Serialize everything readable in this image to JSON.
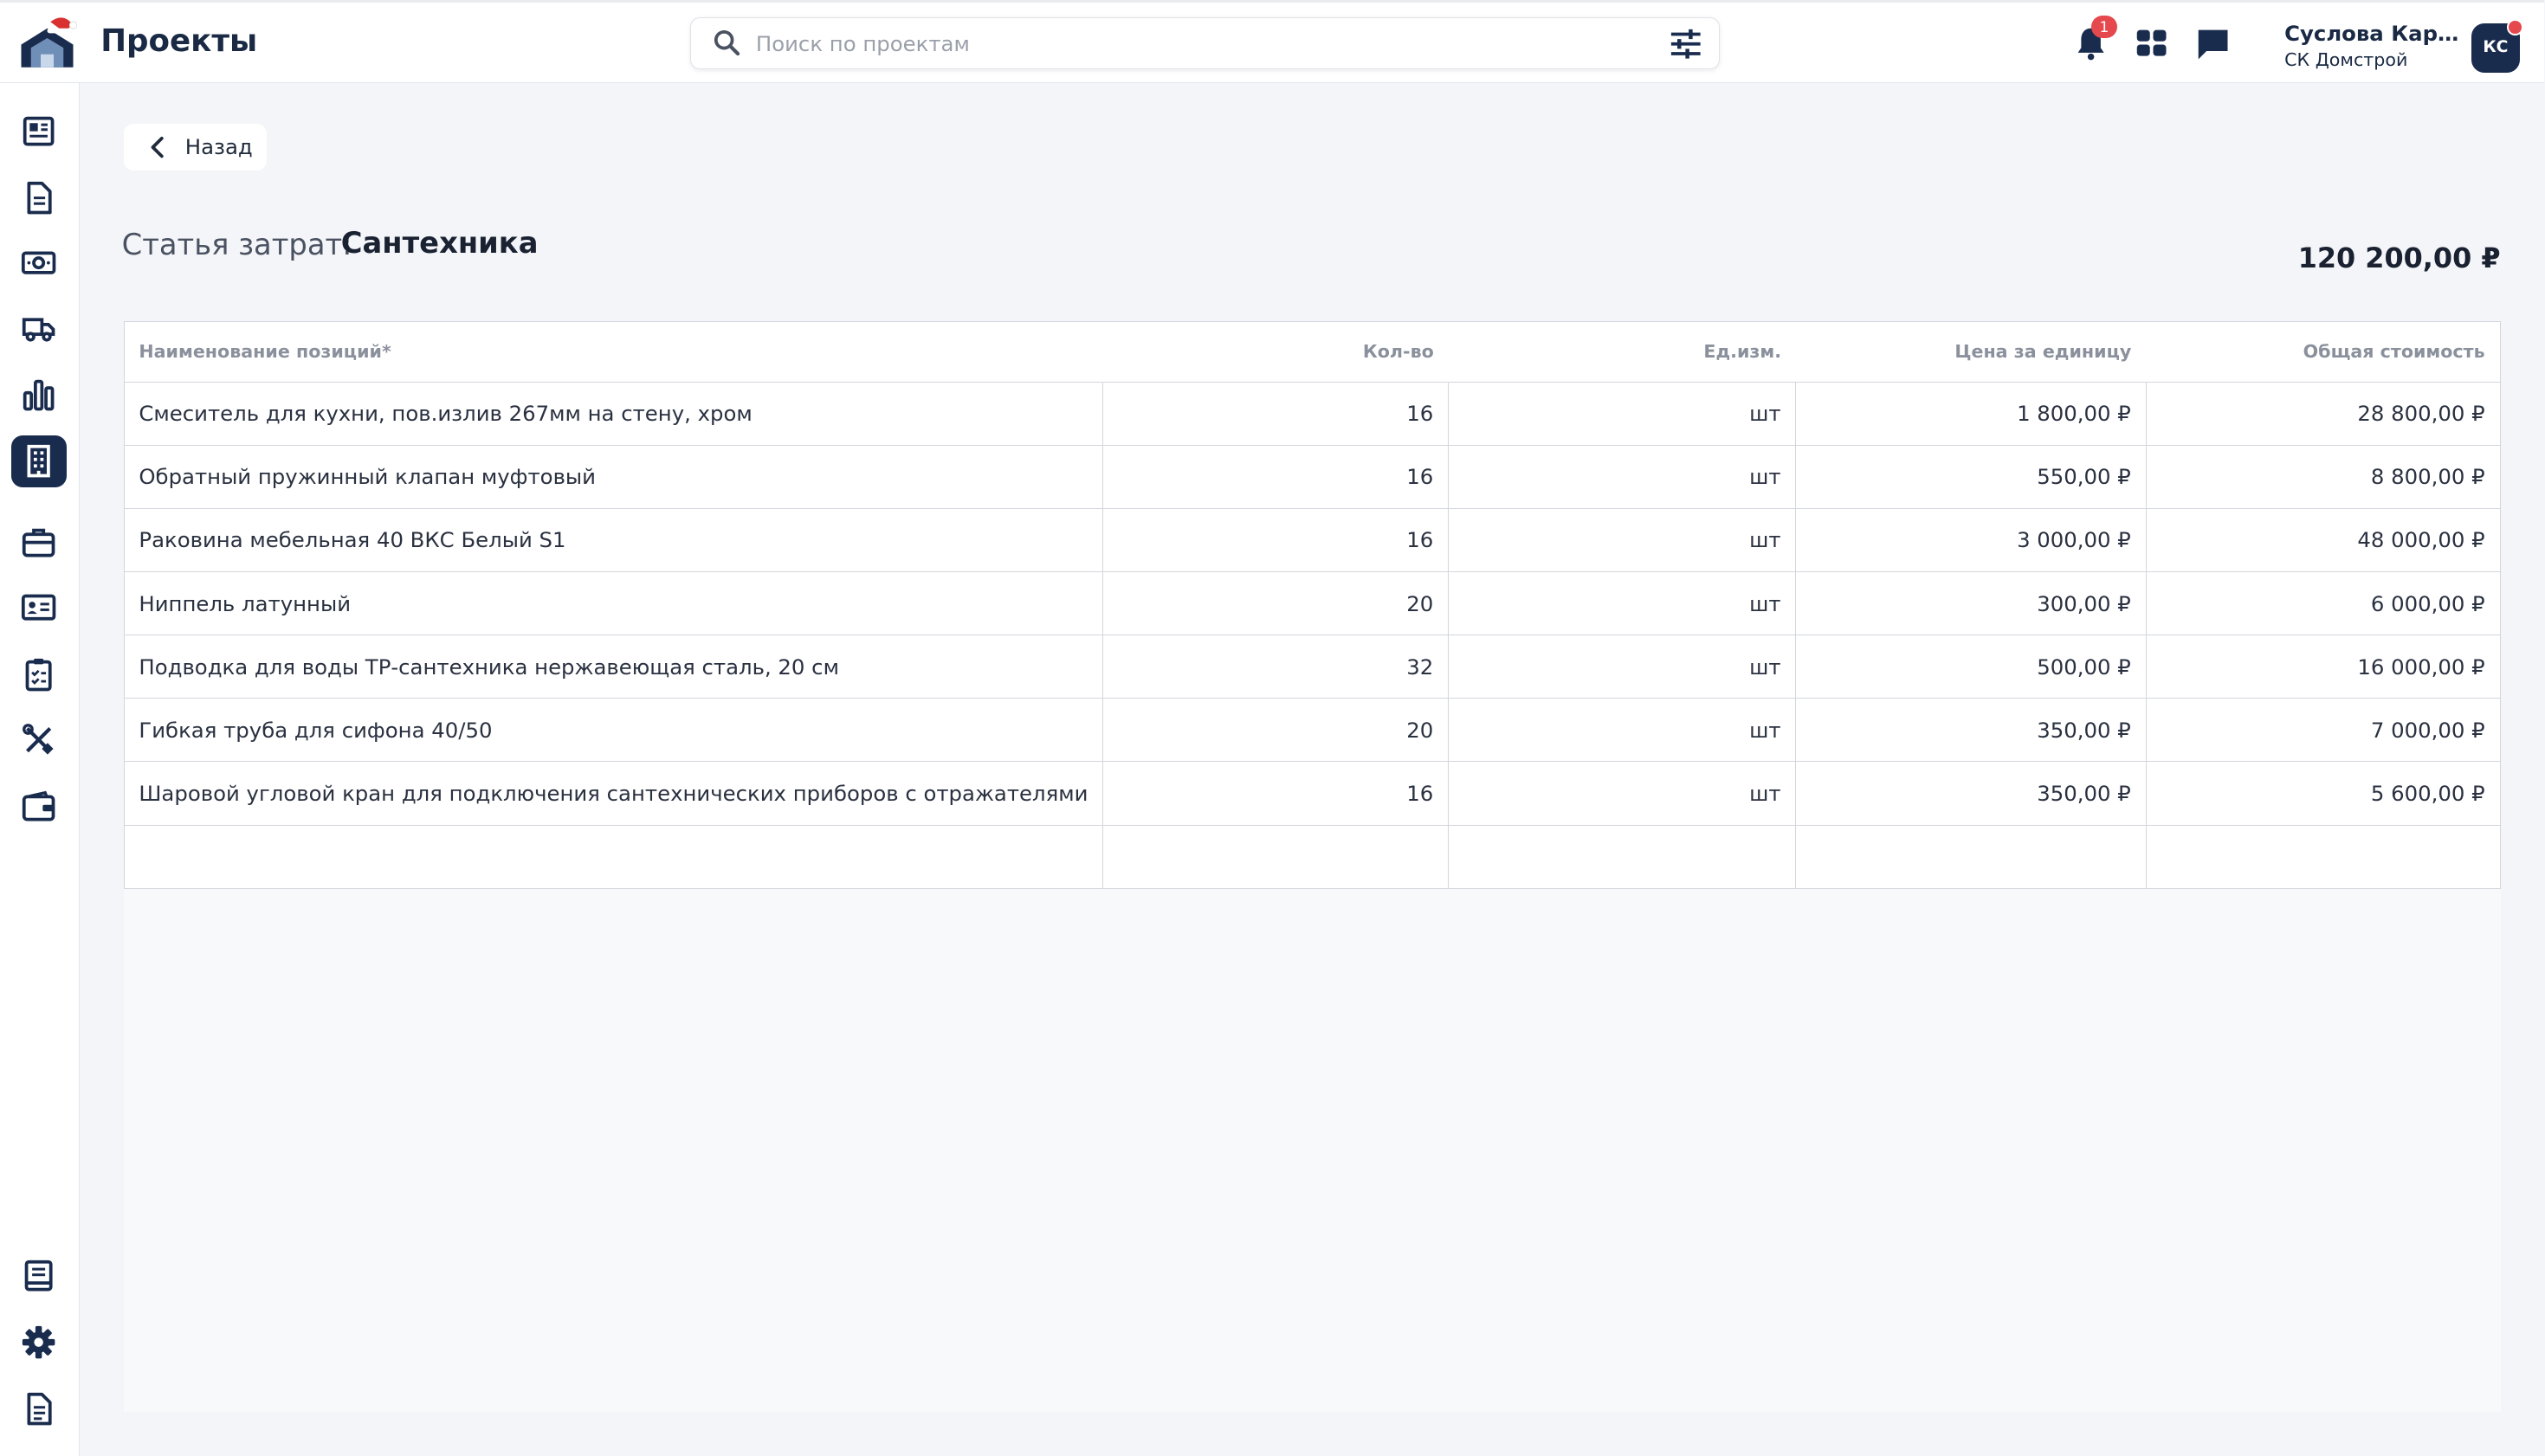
{
  "app": {
    "title": "Проекты"
  },
  "search": {
    "placeholder": "Поиск по проектам"
  },
  "notifications": {
    "count": "1"
  },
  "user": {
    "name": "Суслова Кари...",
    "company": "СК Домстрой",
    "initials": "КС"
  },
  "back": {
    "label": "Назад"
  },
  "cost_item": {
    "label": "Статья затрат:",
    "name": "Сантехника",
    "total": "120 200,00 ₽"
  },
  "table": {
    "columns": [
      "Наименование позиций*",
      "Кол-во",
      "Ед.изм.",
      "Цена за единицу",
      "Общая стоимость"
    ],
    "rows": [
      [
        "Смеситель для кухни, пов.излив 267мм на стену, хром",
        "16",
        "шт",
        "1 800,00 ₽",
        "28 800,00 ₽"
      ],
      [
        "Обратный пружинный клапан муфтовый",
        "16",
        "шт",
        "550,00 ₽",
        "8 800,00 ₽"
      ],
      [
        "Раковина мебельная 40 ВКС Белый S1",
        "16",
        "шт",
        "3 000,00 ₽",
        "48 000,00 ₽"
      ],
      [
        "Ниппель латунный",
        "20",
        "шт",
        "300,00 ₽",
        "6 000,00 ₽"
      ],
      [
        "Подводка для воды ТР-сантехника нержавеющая сталь, 20 см",
        "32",
        "шт",
        "500,00 ₽",
        "16 000,00 ₽"
      ],
      [
        "Гибкая труба для сифона 40/50",
        "20",
        "шт",
        "350,00 ₽",
        "7 000,00 ₽"
      ],
      [
        "Шаровой угловой кран для подключения сантехнических приборов с отражателями",
        "16",
        "шт",
        "350,00 ₽",
        "5 600,00 ₽"
      ],
      [
        "",
        "",
        "",
        "",
        ""
      ]
    ]
  },
  "sidebar": {
    "items": [
      {
        "icon": "newspaper-icon"
      },
      {
        "icon": "document-icon"
      },
      {
        "icon": "money-icon"
      },
      {
        "icon": "delivery-truck-icon"
      },
      {
        "icon": "bar-chart-icon"
      },
      {
        "icon": "building-icon",
        "active": true
      },
      {
        "icon": "briefcase-icon"
      },
      {
        "icon": "id-card-icon"
      },
      {
        "icon": "checklist-icon"
      },
      {
        "icon": "tools-icon"
      },
      {
        "icon": "wallet-icon"
      }
    ],
    "bottom": [
      {
        "icon": "book-icon"
      },
      {
        "icon": "gear-icon"
      },
      {
        "icon": "file-text-icon"
      }
    ]
  },
  "colors": {
    "accent": "#1a2c4e",
    "badge": "#e5484d",
    "background": "#f4f5f8"
  }
}
